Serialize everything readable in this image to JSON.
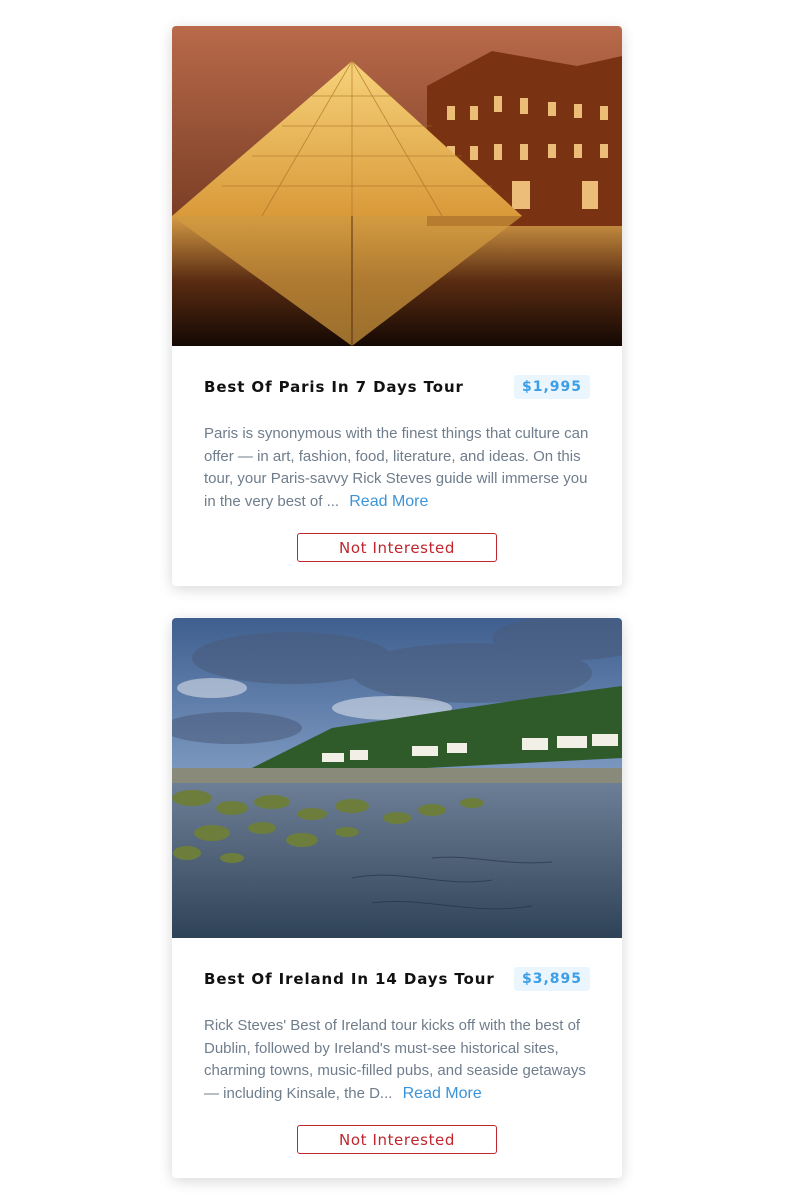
{
  "tours": [
    {
      "title": "Best Of Paris In 7 Days Tour",
      "price": "$1,995",
      "description": "Paris is synonymous with the finest things that culture can offer — in art, fashion, food, literature, and ideas. On this tour, your Paris-savvy Rick Steves guide will immerse you in the very best of ...",
      "read_more": "Read More",
      "not_interested": "Not Interested"
    },
    {
      "title": "Best Of Ireland In 14 Days Tour",
      "price": "$3,895",
      "description": "Rick Steves' Best of Ireland tour kicks off with the best of Dublin, followed by Ireland's must-see historical sites, charming towns, music-filled pubs, and seaside getaways — including Kinsale, the D...",
      "read_more": "Read More",
      "not_interested": "Not Interested"
    }
  ],
  "colors": {
    "price_text": "#3c9ee6",
    "price_bg": "#eaf5fd",
    "read_more": "#3c94d8",
    "not_interested": "#c0262d",
    "description": "#6f7d8c"
  }
}
